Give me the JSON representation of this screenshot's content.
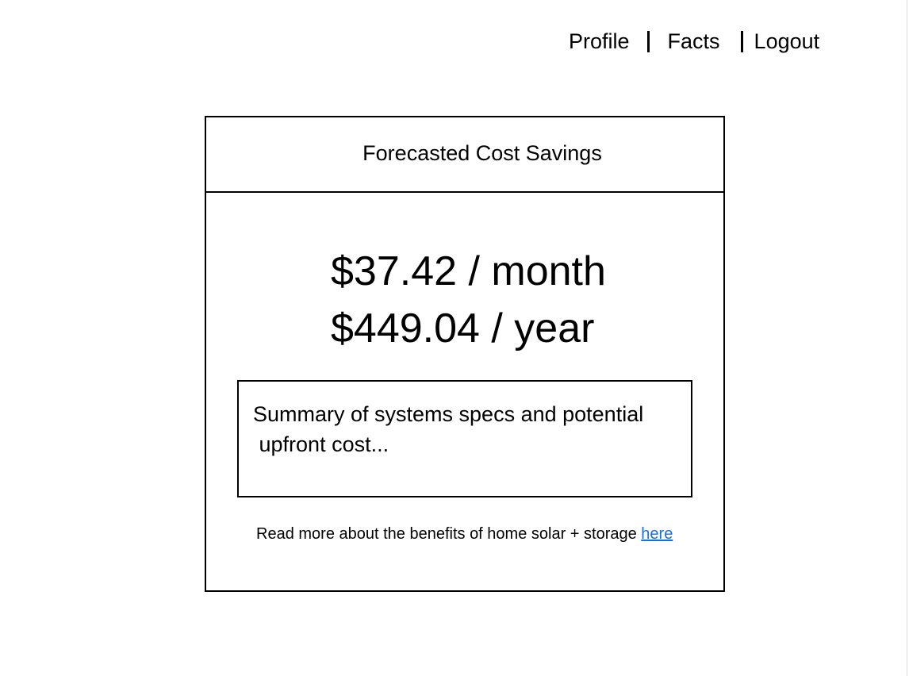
{
  "nav": {
    "items": [
      {
        "label": "Profile"
      },
      {
        "label": "Facts"
      },
      {
        "label": "Logout"
      }
    ]
  },
  "card": {
    "title": "Forecasted Cost Savings",
    "monthly": "$37.42 / month",
    "yearly": "$449.04 / year",
    "summary": "Summary of systems specs and potential\n upfront cost...",
    "readmore_text": "Read more about the benefits of home solar + storage ",
    "readmore_link": "here"
  },
  "colors": {
    "link": "#1a6fd6",
    "border": "#000000",
    "background": "#ffffff"
  }
}
